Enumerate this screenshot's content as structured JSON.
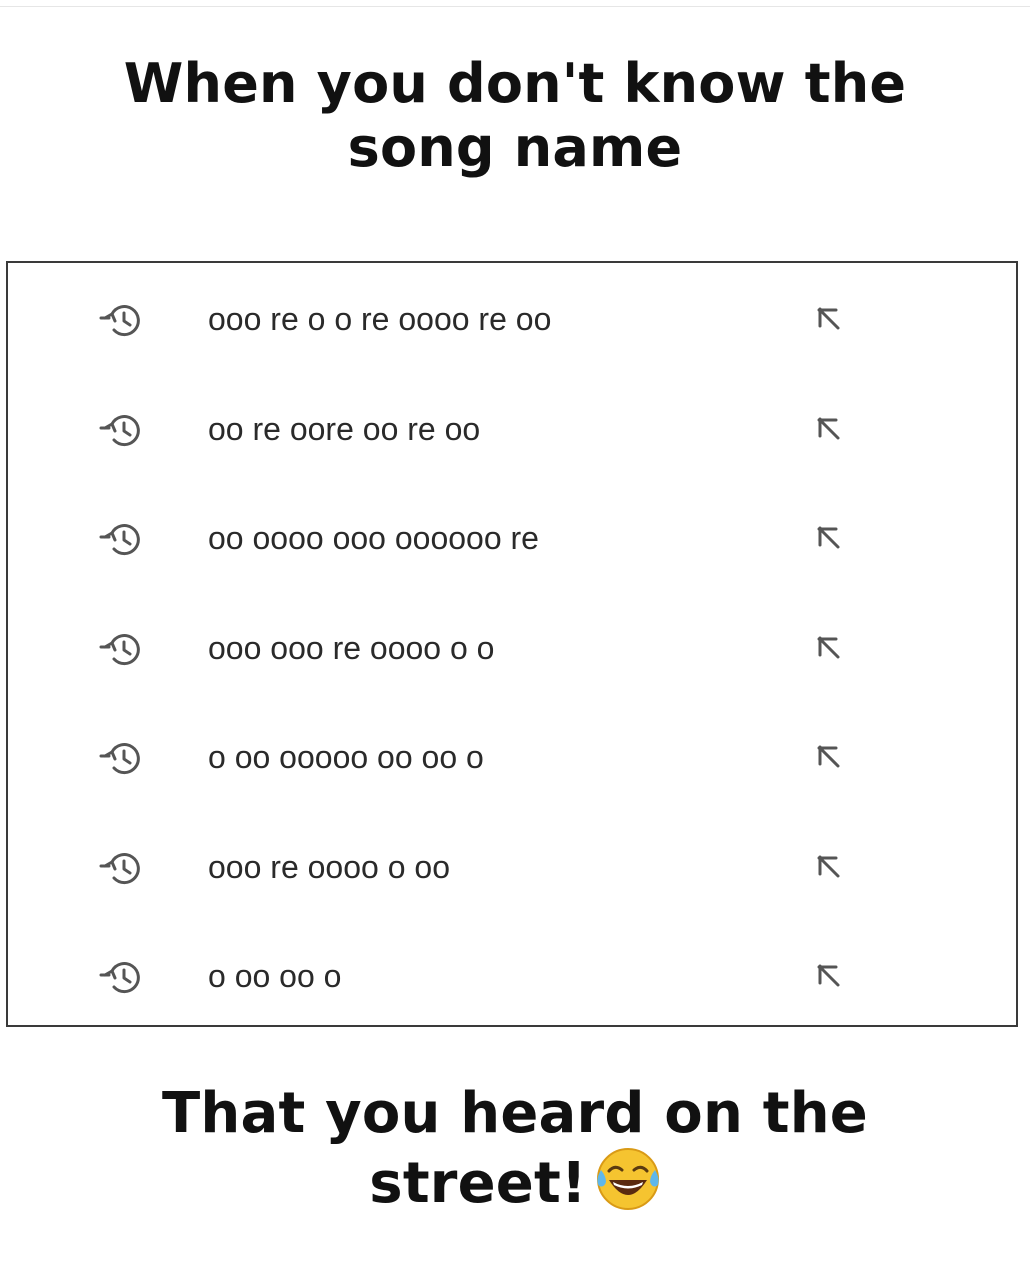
{
  "caption_top": "When you don't know the song name",
  "caption_bottom_text": "That you heard on the street!",
  "caption_bottom_emoji": "face-with-tears-of-joy-icon",
  "history": {
    "items": [
      {
        "query": "ooo re o o re oooo re oo",
        "icon": "history-icon",
        "action_icon": "fill-query-arrow-icon"
      },
      {
        "query": "oo re oore oo re oo",
        "icon": "history-icon",
        "action_icon": "fill-query-arrow-icon"
      },
      {
        "query": "oo oooo ooo oooooo re",
        "icon": "history-icon",
        "action_icon": "fill-query-arrow-icon"
      },
      {
        "query": "ooo ooo re oooo o o",
        "icon": "history-icon",
        "action_icon": "fill-query-arrow-icon"
      },
      {
        "query": "o oo ooooo oo oo o",
        "icon": "history-icon",
        "action_icon": "fill-query-arrow-icon"
      },
      {
        "query": "ooo re oooo o oo",
        "icon": "history-icon",
        "action_icon": "fill-query-arrow-icon"
      },
      {
        "query": "o oo oo o",
        "icon": "history-icon",
        "action_icon": "fill-query-arrow-icon"
      }
    ]
  },
  "colors": {
    "text": "#111111",
    "query_text": "#2a2a2a",
    "icon": "#555555",
    "panel_border": "#3a3a3a",
    "emoji_face": "#f5c430"
  }
}
